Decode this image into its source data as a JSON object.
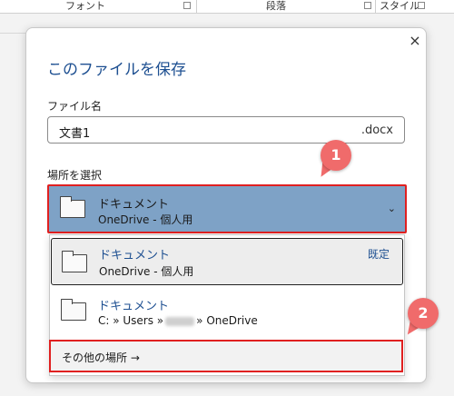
{
  "ribbon": {
    "groups": [
      "フォント",
      "段落",
      "スタイル"
    ]
  },
  "dialog": {
    "title": "このファイルを保存",
    "close_glyph": "×",
    "filename_label": "ファイル名",
    "filename_value": "文書1",
    "filename_ext": ".docx",
    "location_label": "場所を選択",
    "selected": {
      "name": "ドキュメント",
      "sub": "OneDrive - 個人用",
      "chevron": "⌄"
    },
    "options": [
      {
        "name": "ドキュメント",
        "sub": "OneDrive - 個人用",
        "badge": "既定"
      },
      {
        "name": "ドキュメント",
        "path_prefix": "C: » Users »",
        "path_suffix": "» OneDrive"
      }
    ],
    "other_locations": "その他の場所 →"
  },
  "callouts": [
    "1",
    "2"
  ],
  "colors": {
    "accent": "#1d4f91",
    "selected_bg": "#7ea2c6",
    "highlight_red": "#e02020",
    "callout": "#f06b6b"
  }
}
